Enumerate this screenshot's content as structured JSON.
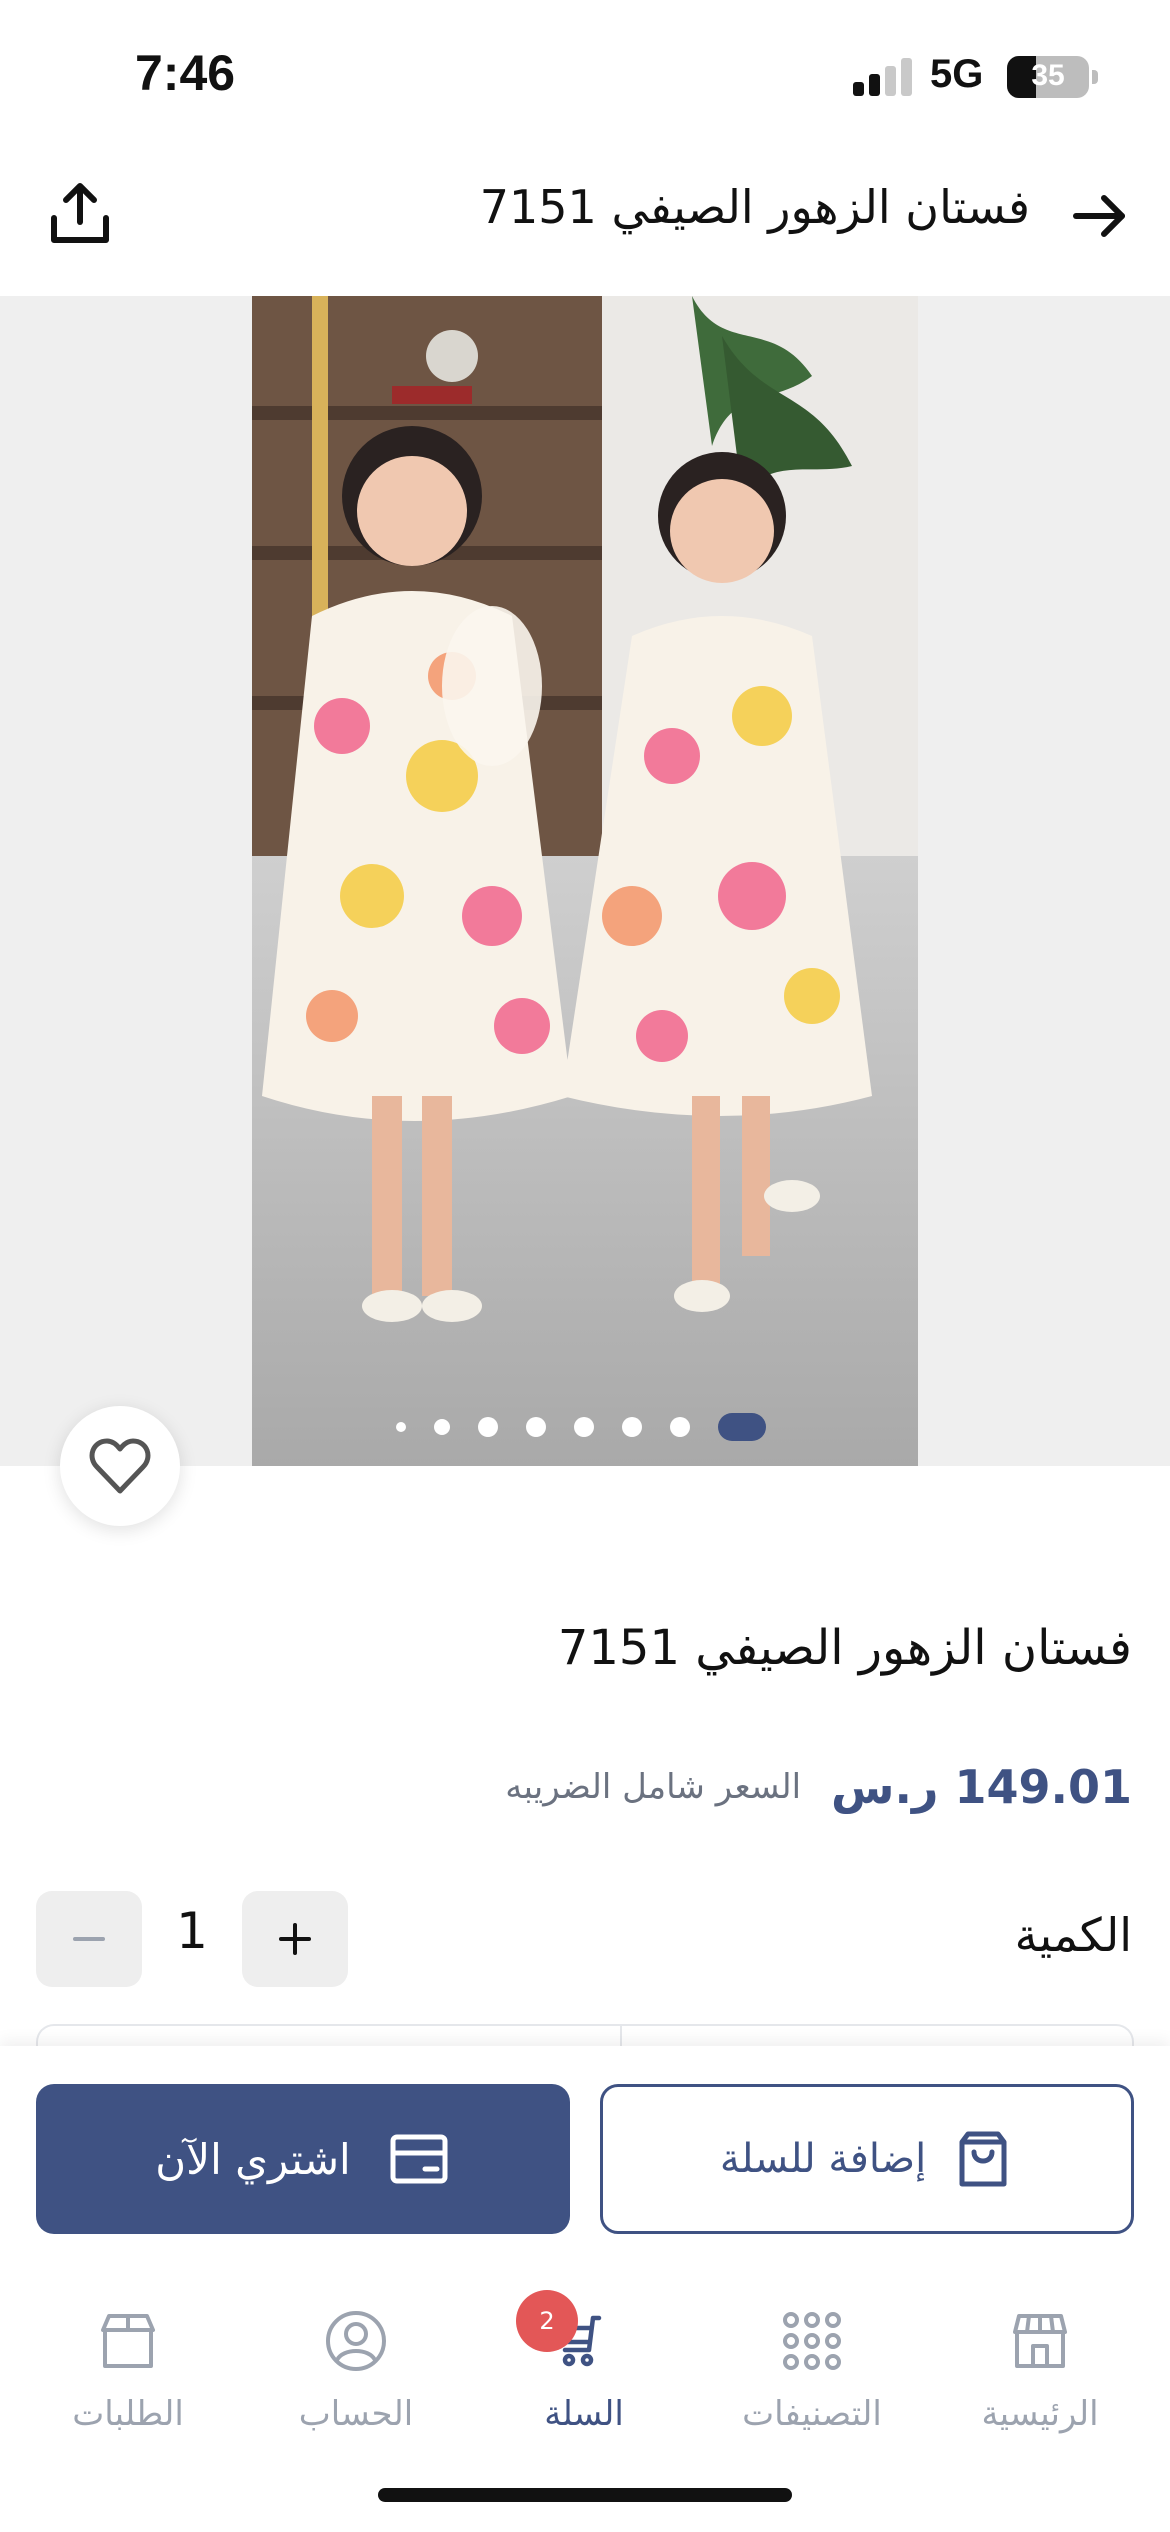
{
  "status_bar": {
    "time": "7:46",
    "network": "5G",
    "battery": "35",
    "battery_level": 0.35
  },
  "header": {
    "title": "فستان الزهور الصيفي 7151"
  },
  "gallery": {
    "image_count": 8,
    "active_index": 7
  },
  "product": {
    "title": "فستان الزهور الصيفي 7151",
    "price": "149.01 ر.س",
    "tax_note": "السعر شامل الضريبه",
    "quantity_label": "الكمية",
    "quantity": "1"
  },
  "actions": {
    "buy_now": "اشتري الآن",
    "add_to_cart": "إضافة للسلة"
  },
  "nav": {
    "items": [
      {
        "label": "الرئيسية",
        "icon": "store-icon"
      },
      {
        "label": "التصنيفات",
        "icon": "grid-icon"
      },
      {
        "label": "السلة",
        "icon": "cart-icon",
        "badge": "2",
        "active": true
      },
      {
        "label": "الحساب",
        "icon": "user-icon"
      },
      {
        "label": "الطلبات",
        "icon": "box-icon"
      }
    ]
  },
  "colors": {
    "primary": "#3f5283",
    "badge": "#e35757",
    "muted": "#9ca3af"
  }
}
